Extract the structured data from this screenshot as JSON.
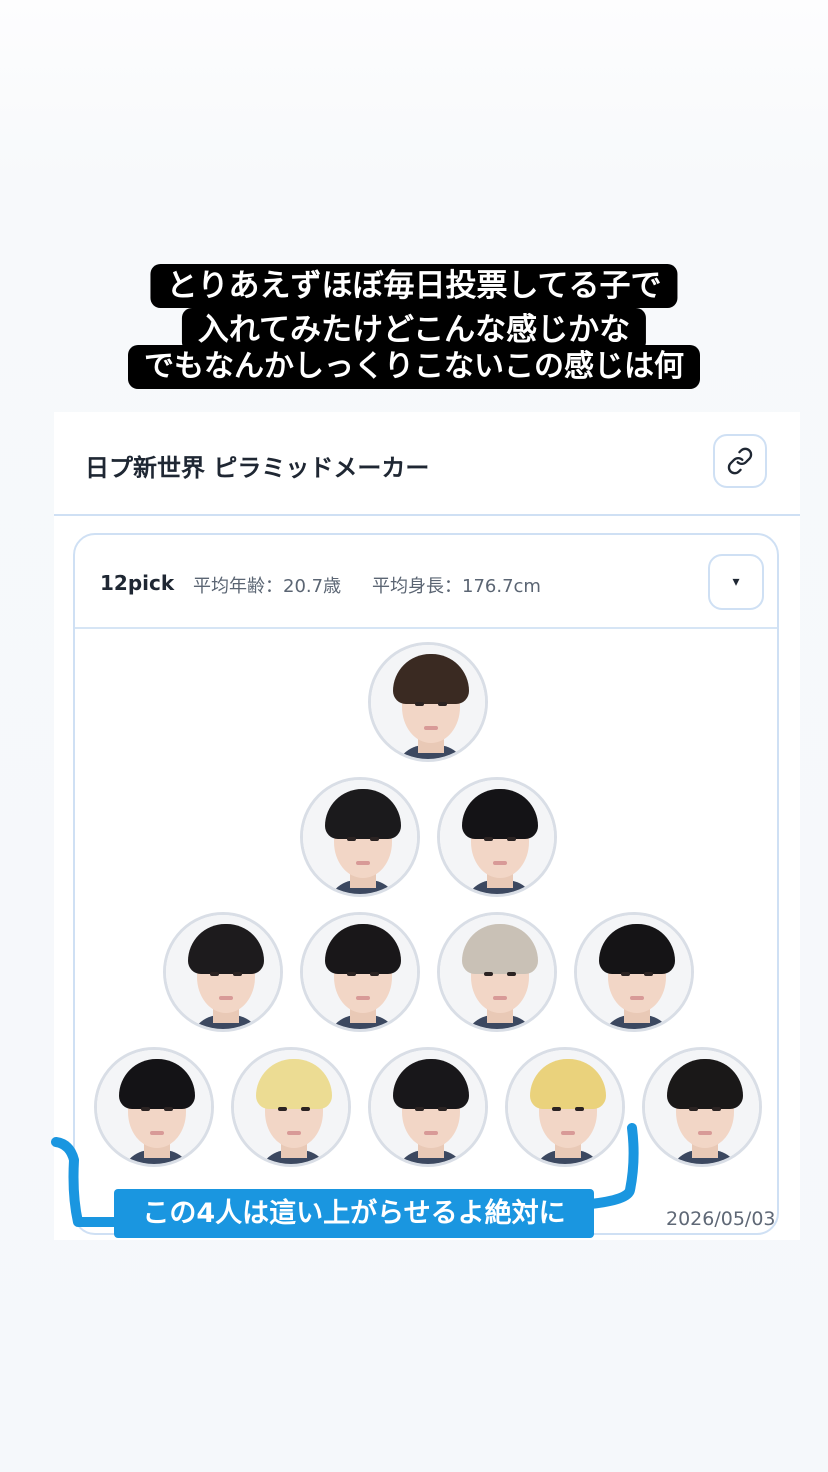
{
  "caption": {
    "line1": "とりあえずほぼ毎日投票してる子で",
    "line2": "入れてみたけどこんな感じかな",
    "line3": "でもなんかしっくりこないこの感じは何"
  },
  "app": {
    "title": "日プ新世界 ピラミッドメーカー",
    "link_icon": "link-icon"
  },
  "summary": {
    "pick_count": "12pick",
    "avg_age": "平均年齢：20.7歳",
    "avg_height": "平均身長：176.7cm",
    "dropdown_symbol": "▾"
  },
  "pyramid": {
    "rows": [
      [
        {
          "hair": "#3a2a22"
        }
      ],
      [
        {
          "hair": "#1b1a1c"
        },
        {
          "hair": "#141316"
        }
      ],
      [
        {
          "hair": "#1d1b1d"
        },
        {
          "hair": "#191719"
        },
        {
          "hair": "#c9c1b6"
        },
        {
          "hair": "#151416"
        }
      ],
      [
        {
          "hair": "#141316"
        },
        {
          "hair": "#ecdc93"
        },
        {
          "hair": "#18171a"
        },
        {
          "hair": "#ead27c"
        },
        {
          "hair": "#1a1818"
        }
      ]
    ]
  },
  "date": "2026/05/03",
  "annotation": {
    "text": "この4人は這い上がらせるよ絶対に",
    "color": "#1a96e0"
  }
}
